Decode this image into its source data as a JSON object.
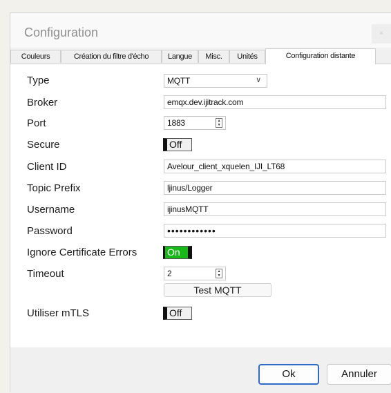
{
  "window": {
    "title": "Configuration",
    "close_glyph": "×"
  },
  "tabs": [
    {
      "label": "Couleurs"
    },
    {
      "label": "Création du filtre d'écho"
    },
    {
      "label": "Langue"
    },
    {
      "label": "Misc."
    },
    {
      "label": "Unités"
    },
    {
      "label": "Configuration distante",
      "active": true
    }
  ],
  "form": {
    "type": {
      "label": "Type",
      "value": "MQTT"
    },
    "broker": {
      "label": "Broker",
      "value": "emqx.dev.ijitrack.com"
    },
    "port": {
      "label": "Port",
      "value": "1883"
    },
    "secure": {
      "label": "Secure",
      "value": "Off"
    },
    "client_id": {
      "label": "Client ID",
      "value": "Avelour_client_xquelen_IJI_LT68"
    },
    "topic_prefix": {
      "label": "Topic Prefix",
      "value": "ljinus/Logger"
    },
    "username": {
      "label": "Username",
      "value": "ijinusMQTT"
    },
    "password": {
      "label": "Password",
      "value": "••••••••••••"
    },
    "ignore_cert": {
      "label": "Ignore Certificate Errors",
      "value": "On"
    },
    "timeout": {
      "label": "Timeout",
      "value": "2"
    },
    "test_button": "Test MQTT",
    "mtls": {
      "label": "Utiliser mTLS",
      "value": "Off"
    }
  },
  "footer": {
    "ok": "Ok",
    "cancel": "Annuler"
  },
  "colors": {
    "toggle_on": "#17b817",
    "ok_border": "#2d6bc7"
  }
}
